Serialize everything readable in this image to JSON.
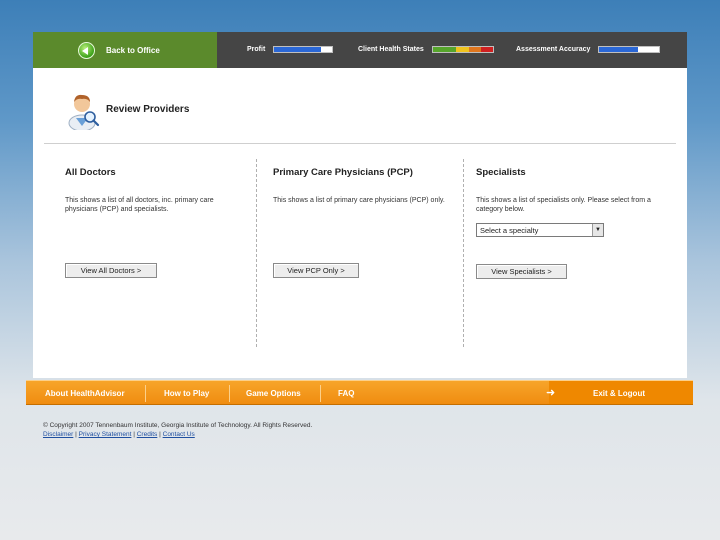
{
  "header": {
    "back_label": "Back to Office",
    "meters": [
      {
        "label": "Profit",
        "segments": [
          {
            "color": "#2a67d6",
            "fraction": 0.8
          }
        ]
      },
      {
        "label": "Client Health States",
        "segments": [
          {
            "color": "#56a52b",
            "fraction": 0.38
          },
          {
            "color": "#f0c31e",
            "fraction": 0.22
          },
          {
            "color": "#e0761d",
            "fraction": 0.2
          },
          {
            "color": "#cf2020",
            "fraction": 0.2
          }
        ]
      },
      {
        "label": "Assessment Accuracy",
        "segments": [
          {
            "color": "#2a67d6",
            "fraction": 0.65
          }
        ]
      }
    ]
  },
  "page": {
    "title": "Review Providers"
  },
  "columns": {
    "all": {
      "title": "All Doctors",
      "desc": "This shows a list of all doctors, inc. primary care physicians (PCP) and specialists.",
      "button": "View All Doctors >"
    },
    "pcp": {
      "title": "Primary Care Physicians (PCP)",
      "desc": "This shows a list of primary care physicians (PCP) only.",
      "button": "View PCP Only >"
    },
    "spec": {
      "title": "Specialists",
      "desc": "This shows a list of specialists only. Please select from a category below.",
      "select_value": "Select a specialty",
      "button": "View Specialists >"
    }
  },
  "footer": {
    "links": [
      "About HealthAdvisor",
      "How to Play",
      "Game Options",
      "FAQ"
    ],
    "exit": "Exit & Logout",
    "copyright": "© Copyright 2007 Tennenbaum Institute, Georgia Institute of Technology. All Rights Reserved.",
    "legal": [
      "Disclaimer",
      "Privacy Statement",
      "Credits",
      "Contact Us"
    ]
  },
  "colors": {
    "header_bg": "#454545",
    "back_bg": "#5b8a2c",
    "footer_orange": "#f08c10"
  }
}
